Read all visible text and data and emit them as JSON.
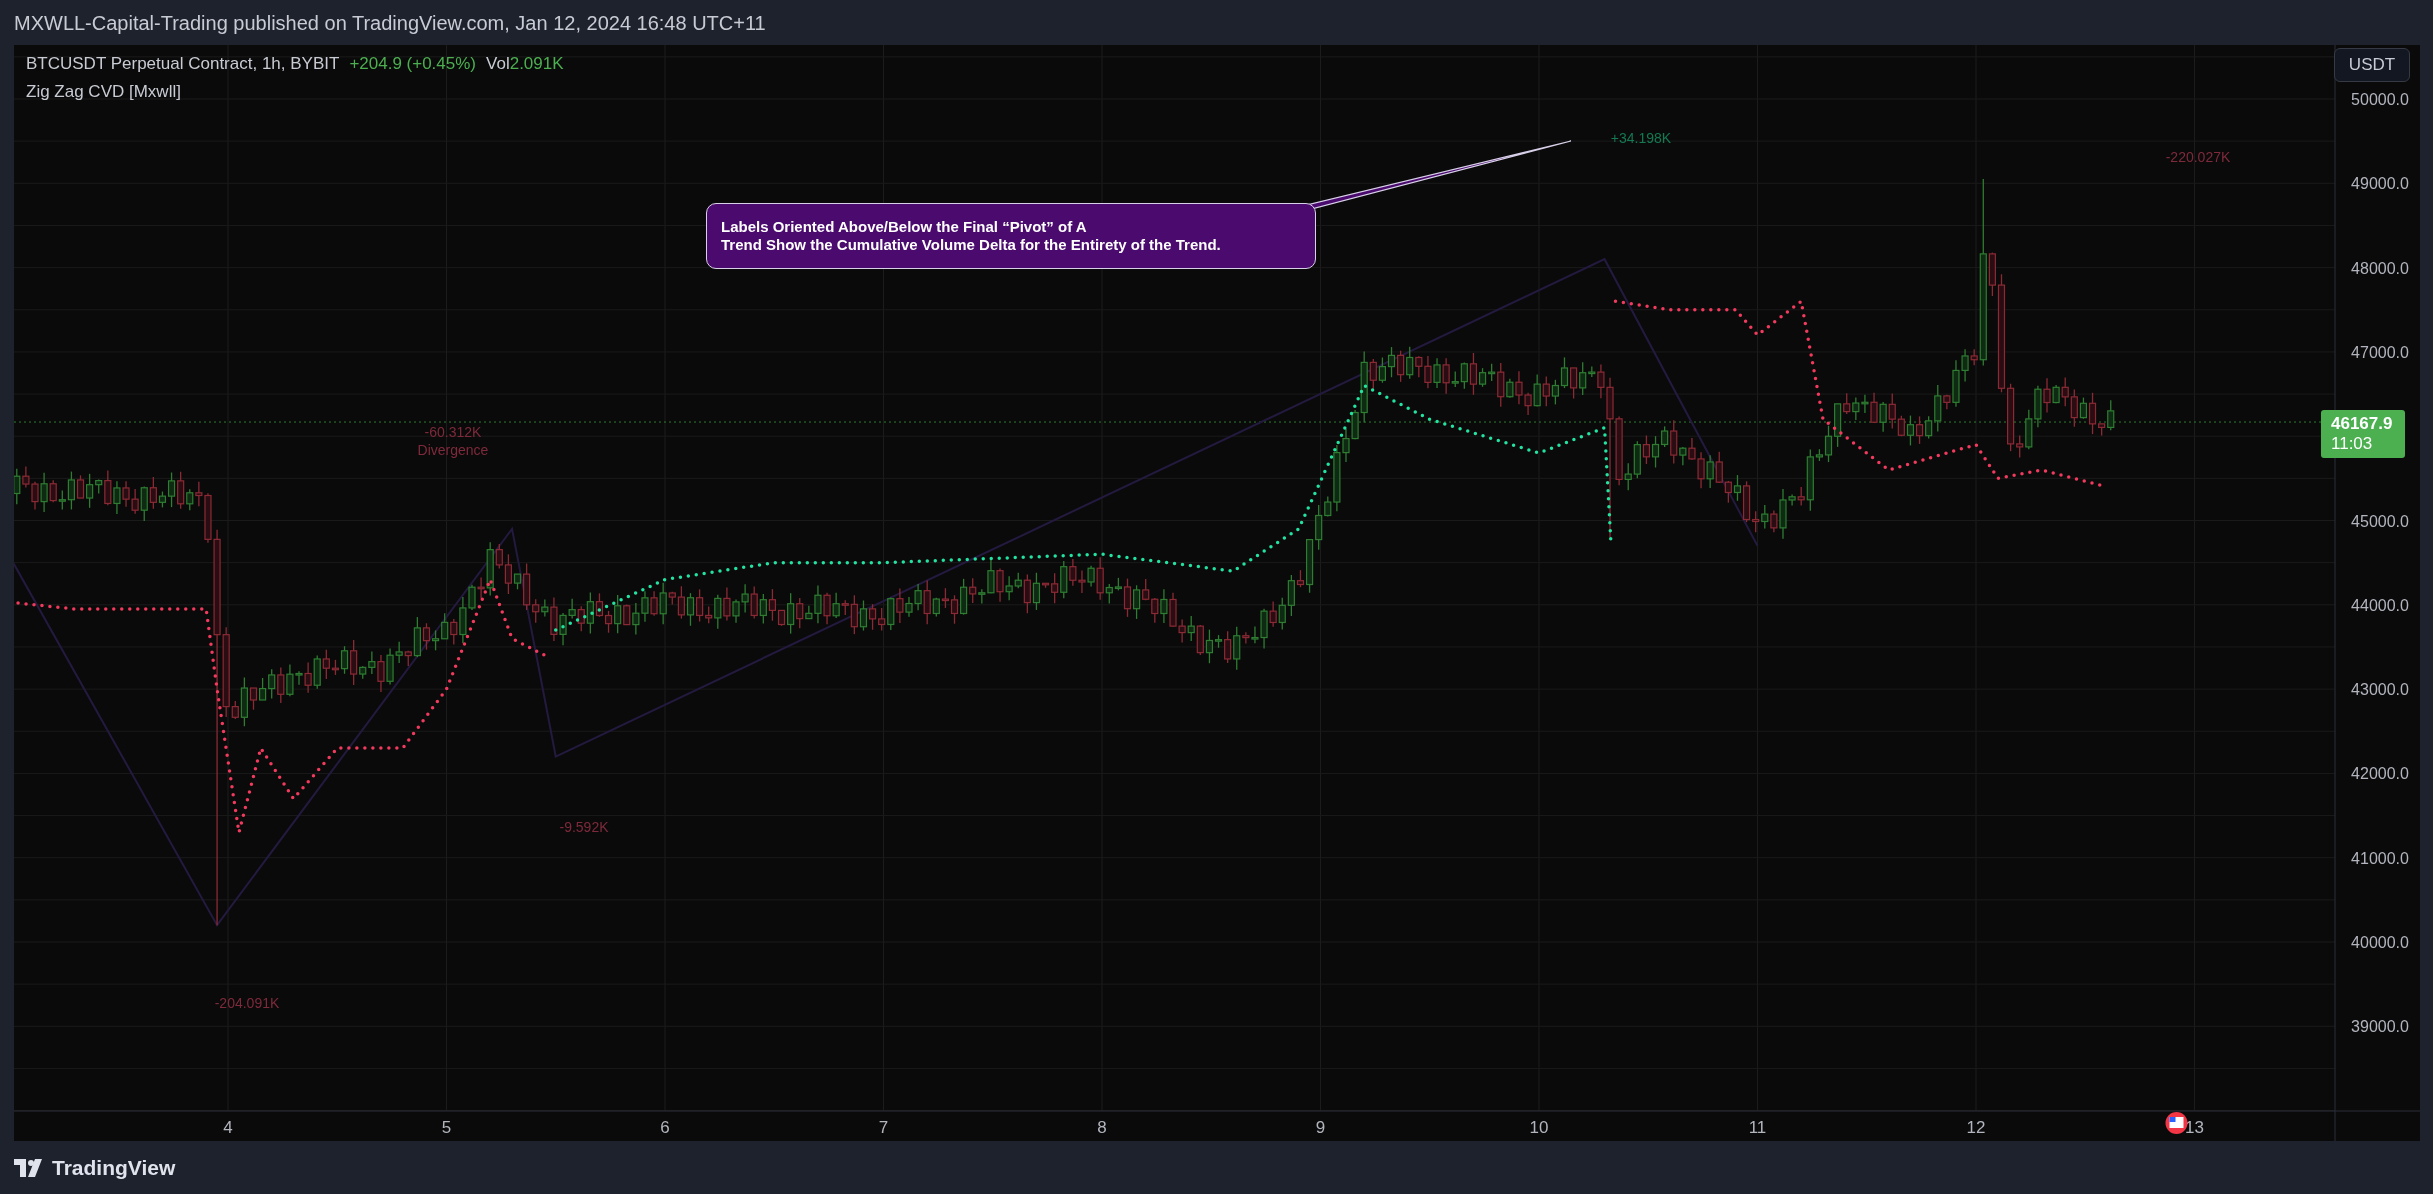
{
  "header": {
    "text": "MXWLL-Capital-Trading published on TradingView.com, Jan 12, 2024 16:48 UTC+11"
  },
  "legend": {
    "symbol": "BTCUSDT Perpetual Contract, 1h, BYBIT",
    "change": "+204.9 (+0.45%)",
    "volume_label": "Vol",
    "volume_value": "2.091K",
    "indicator": "Zig Zag CVD [Mxwll]"
  },
  "currency_button": "USDT",
  "price_axis": {
    "ticks": [
      "50000.0",
      "49000.0",
      "48000.0",
      "47000.0",
      "45000.0",
      "44000.0",
      "43000.0",
      "42000.0",
      "41000.0",
      "40000.0",
      "39000.0"
    ]
  },
  "last_price": {
    "price": "46167.9",
    "countdown": "11:03"
  },
  "time_axis": {
    "ticks": [
      "4",
      "5",
      "6",
      "7",
      "8",
      "9",
      "10",
      "11",
      "12",
      "13"
    ]
  },
  "cvd_labels": [
    {
      "value": "-60.312K",
      "note": "Divergence",
      "color": "#7e2a3b"
    },
    {
      "value": "-204.091K",
      "color": "#7e2a3b"
    },
    {
      "value": "-9.592K",
      "color": "#7e2a3b"
    },
    {
      "value": "+34.198K",
      "color": "#137a52"
    },
    {
      "value": "-220.027K",
      "color": "#7e2a3b"
    }
  ],
  "callout": {
    "lines": [
      "Labels Oriented Above/Below the Final “Pivot” of A",
      "Trend Show the Cumulative Volume Delta for the Entirety of the Trend."
    ]
  },
  "footer": {
    "brand": "TradingView"
  }
}
